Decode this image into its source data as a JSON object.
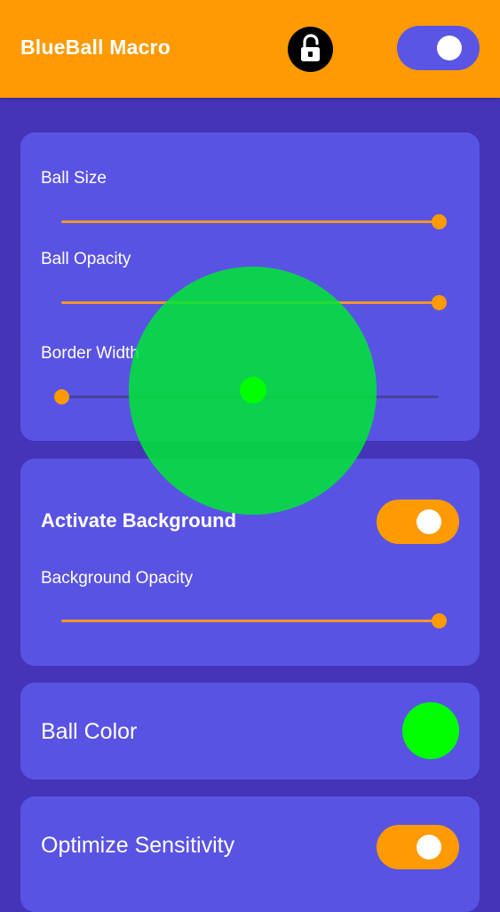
{
  "app": {
    "title": "BlueBall Macro",
    "lock_icon": "lock-open-icon",
    "master_toggle_on": true
  },
  "colors": {
    "appbar": "#fe9a02",
    "background": "#4534b8",
    "card": "#5953e4",
    "accent": "#fe9a02",
    "ball": "#00ff00"
  },
  "ball_settings": {
    "ball_size": {
      "label": "Ball Size",
      "value": 1.0
    },
    "ball_opacity": {
      "label": "Ball Opacity",
      "value": 1.0
    },
    "border_width": {
      "label": "Border Width",
      "value": 0.0
    }
  },
  "background": {
    "activate_label": "Activate Background",
    "activate_on": true,
    "opacity": {
      "label": "Background Opacity",
      "value": 1.0
    }
  },
  "ball_color": {
    "label": "Ball Color",
    "value": "#00ff00"
  },
  "sensitivity": {
    "label": "Optimize Sensitivity",
    "on": true
  }
}
